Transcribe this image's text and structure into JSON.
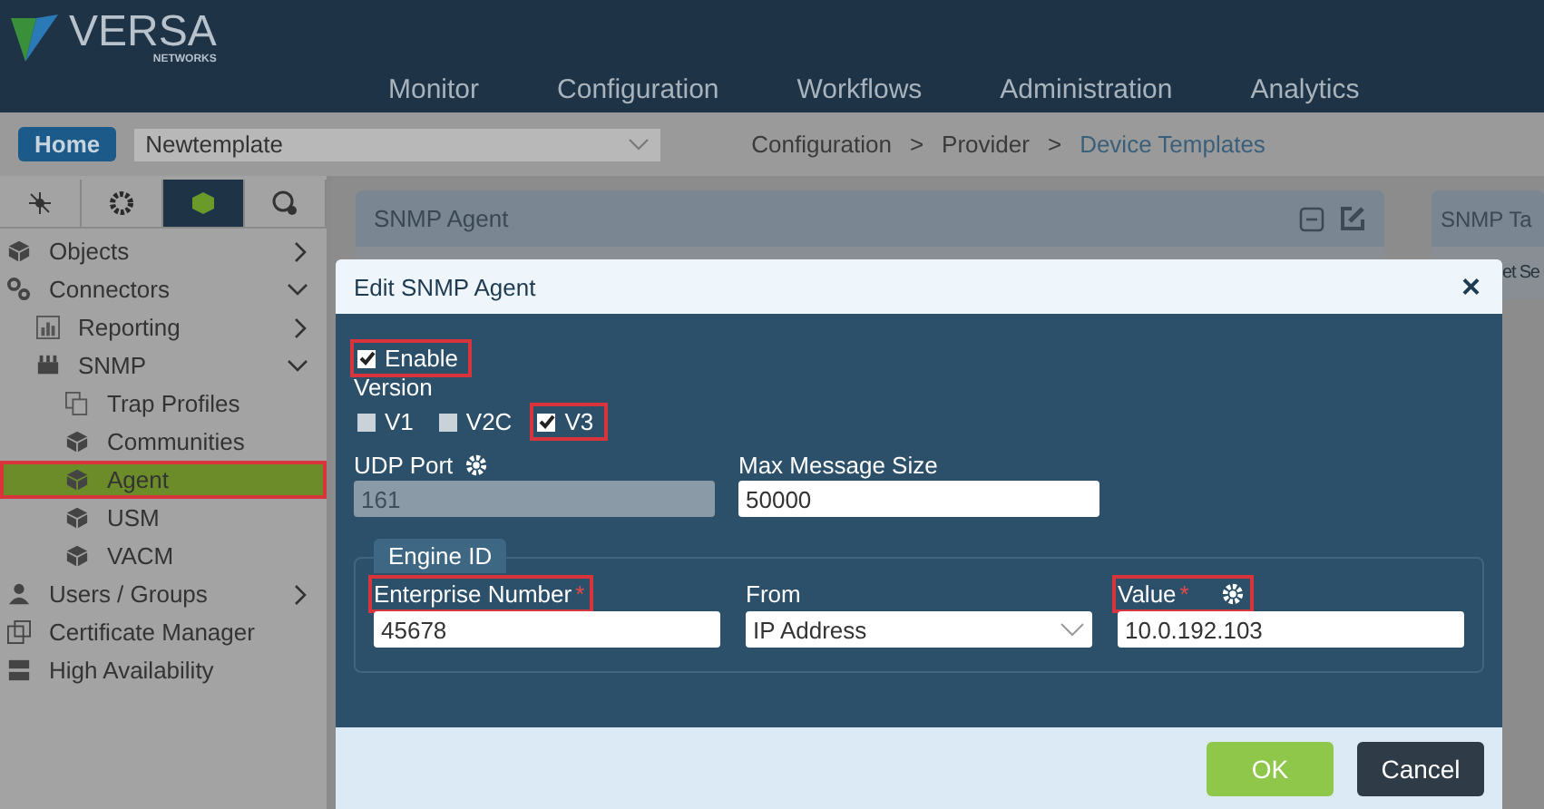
{
  "header": {
    "logo": {
      "name": "VERSA",
      "tagline": "NETWORKS"
    },
    "nav": [
      {
        "label": "Monitor",
        "selected": false
      },
      {
        "label": "Configuration",
        "selected": false
      },
      {
        "label": "Workflows",
        "selected": false
      },
      {
        "label": "Administration",
        "selected": false
      },
      {
        "label": "Analytics",
        "selected": false
      }
    ]
  },
  "toolbar": {
    "home": "Home",
    "template": "Newtemplate",
    "breadcrumb": [
      {
        "label": "Configuration",
        "link": false
      },
      {
        "label": ">",
        "link": false
      },
      {
        "label": "Provider",
        "link": false
      },
      {
        "label": ">",
        "link": false
      },
      {
        "label": "Device Templates",
        "link": true
      }
    ]
  },
  "sidebar": {
    "tabs": [
      {
        "selected": false
      },
      {
        "selected": false
      },
      {
        "selected": true
      },
      {
        "selected": false
      }
    ],
    "items": [
      {
        "label": "Objects",
        "expanded": false,
        "selected": false
      },
      {
        "label": "Connectors",
        "expanded": true,
        "selected": false,
        "children": [
          {
            "label": "Reporting",
            "expanded": false,
            "selected": false
          },
          {
            "label": "SNMP",
            "expanded": true,
            "selected": false,
            "children": [
              {
                "label": "Trap Profiles",
                "selected": false
              },
              {
                "label": "Communities",
                "selected": false
              },
              {
                "label": "Agent",
                "selected": true,
                "highlighted": true
              },
              {
                "label": "USM",
                "selected": false
              },
              {
                "label": "VACM",
                "selected": false
              }
            ]
          }
        ]
      },
      {
        "label": "Users / Groups",
        "expanded": false,
        "selected": false
      },
      {
        "label": "Certificate Manager",
        "selected": false
      },
      {
        "label": "High Availability",
        "selected": false
      }
    ]
  },
  "panels": [
    {
      "title": "SNMP Agent"
    },
    {
      "title": "SNMP Ta",
      "row": "et Se"
    }
  ],
  "dialog": {
    "title": "Edit SNMP Agent",
    "close": "×",
    "enable": {
      "label": "Enable",
      "checked": true,
      "highlighted": true
    },
    "version": {
      "label": "Version",
      "options": [
        {
          "label": "V1",
          "checked": false,
          "highlighted": false
        },
        {
          "label": "V2C",
          "checked": false,
          "highlighted": false
        },
        {
          "label": "V3",
          "checked": true,
          "highlighted": true
        }
      ]
    },
    "udp_port": {
      "label": "UDP Port",
      "value": "161",
      "disabled": true
    },
    "max_message_size": {
      "label": "Max Message Size",
      "value": "50000"
    },
    "engine_id": {
      "legend": "Engine ID",
      "fields": [
        {
          "kind": "input",
          "label": "Enterprise Number",
          "required_mark": "*",
          "value": "45678",
          "highlighted": true
        },
        {
          "kind": "select",
          "label": "From",
          "value": "IP Address",
          "highlighted": false
        },
        {
          "kind": "input",
          "label": "Value",
          "required_mark": "*",
          "value": "10.0.192.103",
          "highlighted": true,
          "gear": true
        }
      ]
    },
    "buttons": [
      {
        "label": "OK",
        "kind": "primary"
      },
      {
        "label": "Cancel",
        "kind": "secondary"
      }
    ]
  }
}
